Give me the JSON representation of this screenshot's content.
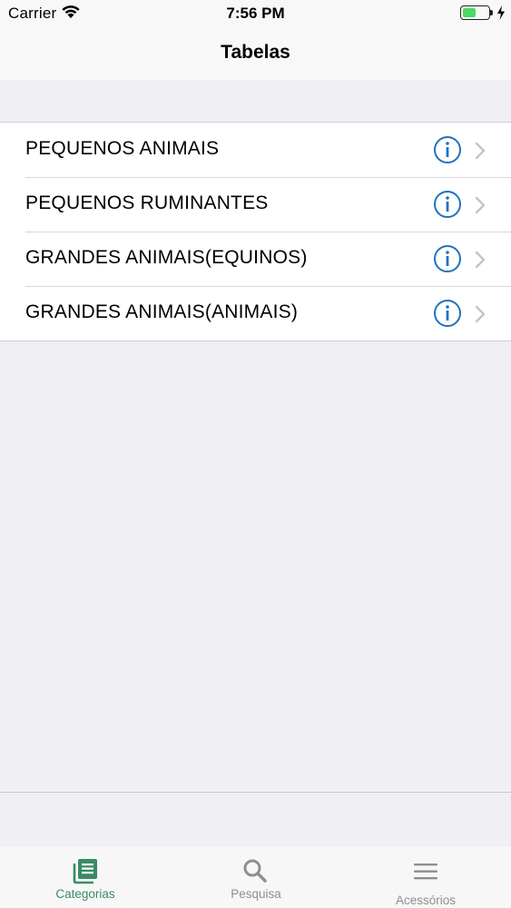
{
  "status_bar": {
    "carrier": "Carrier",
    "time": "7:56 PM",
    "battery_level": 0.52
  },
  "nav": {
    "title": "Tabelas"
  },
  "list": {
    "items": [
      {
        "label": "PEQUENOS ANIMAIS"
      },
      {
        "label": "PEQUENOS RUMINANTES"
      },
      {
        "label": "GRANDES ANIMAIS(EQUINOS)"
      },
      {
        "label": "GRANDES ANIMAIS(ANIMAIS)"
      }
    ]
  },
  "tabs": [
    {
      "label": "Categorias",
      "icon": "book-icon",
      "selected": true
    },
    {
      "label": "Pesquisa",
      "icon": "search-icon",
      "selected": false
    },
    {
      "label": "Acessórios",
      "icon": "menu-icon",
      "selected": false
    }
  ],
  "colors": {
    "accent": "#1e73be",
    "tab_selected": "#3a8a66",
    "tab_unselected": "#8e8e93",
    "battery": "#4cd964",
    "chevron": "#c4c4c7"
  }
}
